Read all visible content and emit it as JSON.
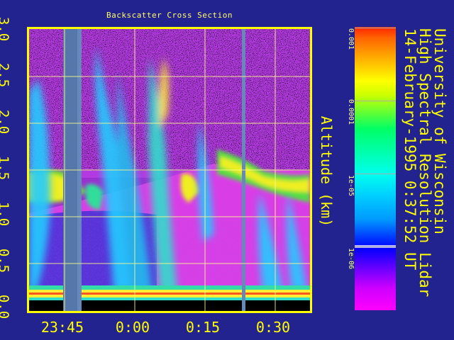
{
  "chart_data": {
    "type": "heatmap",
    "title": "Backscatter Cross Section",
    "xlabel": "",
    "ylabel": "Altitude (km)",
    "x_tick_labels": [
      "23:45",
      "0:00",
      "0:15",
      "0:30"
    ],
    "y_ticks": [
      0.0,
      0.5,
      1.0,
      1.5,
      2.0,
      2.5,
      3.0
    ],
    "y_tick_labels": [
      "0.0",
      "0.5",
      "1.0",
      "1.5",
      "2.0",
      "2.5",
      "3.0"
    ],
    "ylim": [
      0.0,
      3.0
    ],
    "grid": true,
    "colorbar": {
      "scale": "log",
      "range": [
        1e-06,
        0.001
      ],
      "tick_labels": [
        "0.001",
        "0.0001",
        "1e-05",
        "1e-06"
      ]
    }
  },
  "annotations": {
    "institution": "University of Wisconsin",
    "instrument": "High Spectral Resolution Lidar",
    "datetime": "14-February-1995   0:37:52 UT"
  },
  "colors": {
    "background": "#23238f",
    "frame": "#ffff00",
    "grid": "#ffff88",
    "text": "#ffff00"
  }
}
